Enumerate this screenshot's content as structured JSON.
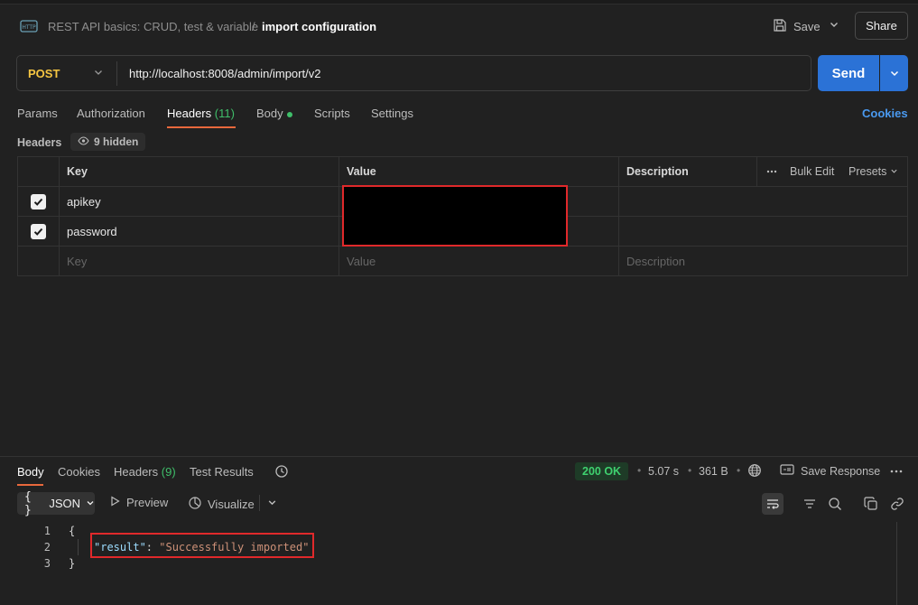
{
  "breadcrumb": {
    "collection": "REST API basics: CRUD, test & variable",
    "separator": "/",
    "request": "import configuration"
  },
  "header_actions": {
    "save_label": "Save",
    "share_label": "Share"
  },
  "request": {
    "method": "POST",
    "method_color": "#f5c542",
    "url": "http://localhost:8008/admin/import/v2",
    "send_label": "Send"
  },
  "request_tabs": [
    {
      "label": "Params"
    },
    {
      "label": "Authorization"
    },
    {
      "label": "Headers",
      "count": "(11)",
      "active": true
    },
    {
      "label": "Body",
      "indicator": "green-dot"
    },
    {
      "label": "Scripts"
    },
    {
      "label": "Settings"
    }
  ],
  "cookies_label": "Cookies",
  "headers_section": {
    "label": "Headers",
    "hidden_count": "9 hidden",
    "columns": {
      "key": "Key",
      "value": "Value",
      "description": "Description"
    },
    "bulk_edit": "Bulk Edit",
    "presets": "Presets",
    "rows": [
      {
        "checked": true,
        "key": "apikey",
        "value": "",
        "description": ""
      },
      {
        "checked": true,
        "key": "password",
        "value": "",
        "description": ""
      }
    ],
    "new_row_placeholders": {
      "key": "Key",
      "value": "Value",
      "description": "Description"
    }
  },
  "response": {
    "tabs": [
      {
        "label": "Body",
        "active": true
      },
      {
        "label": "Cookies"
      },
      {
        "label": "Headers",
        "count": "(9)"
      },
      {
        "label": "Test Results"
      }
    ],
    "status": "200 OK",
    "time": "5.07 s",
    "size": "361 B",
    "save_response_label": "Save Response",
    "format": "JSON",
    "preview_label": "Preview",
    "visualize_label": "Visualize",
    "body_lines": [
      {
        "num": "1",
        "text": "{"
      },
      {
        "num": "2",
        "key": "\"result\"",
        "colon": ": ",
        "value": "\"Successfully imported\""
      },
      {
        "num": "3",
        "text": "}"
      }
    ]
  },
  "colors": {
    "accent_orange": "#e8683c",
    "send_blue": "#2b72d6",
    "success_green": "#3fd16f",
    "redaction_border": "#e0292b"
  }
}
